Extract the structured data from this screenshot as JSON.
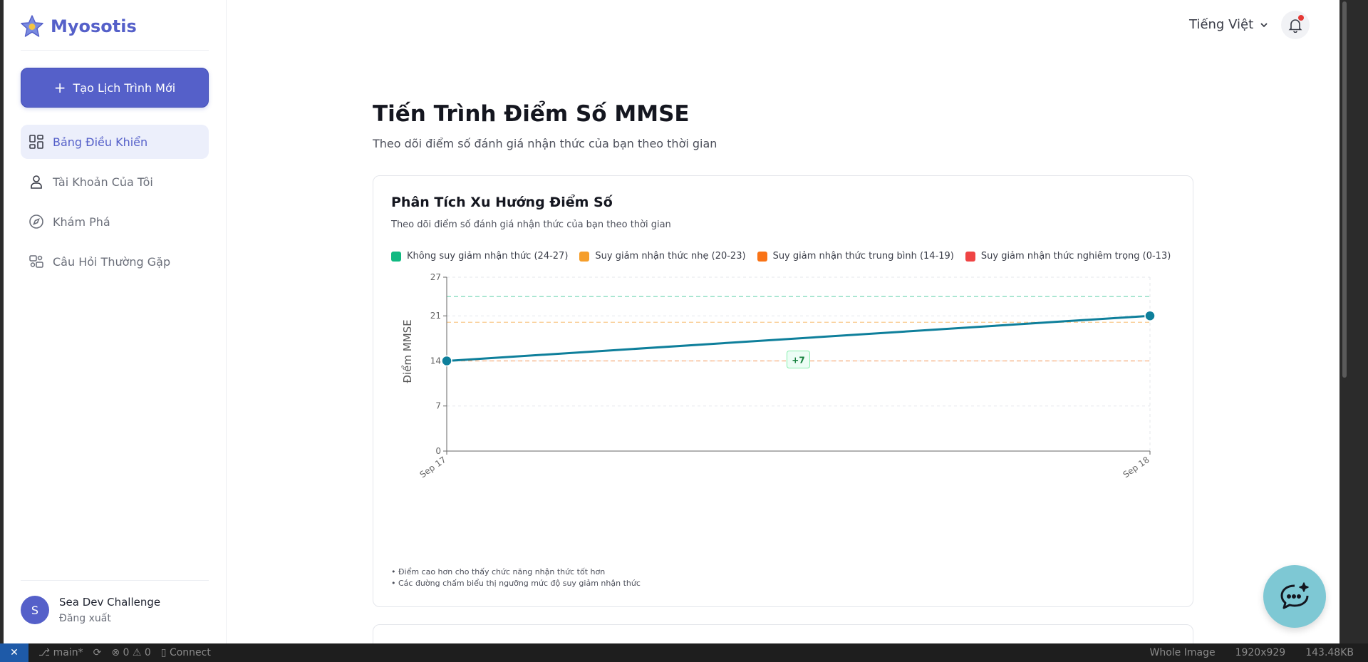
{
  "brand": {
    "name": "Myosotis"
  },
  "sidebar": {
    "new_button": "Tạo Lịch Trình Mới",
    "items": [
      {
        "label": "Bảng Điều Khiển",
        "icon": "dashboard-icon",
        "active": true
      },
      {
        "label": "Tài Khoản Của Tôi",
        "icon": "user-icon",
        "active": false
      },
      {
        "label": "Khám Phá",
        "icon": "compass-icon",
        "active": false
      },
      {
        "label": "Câu Hỏi Thường Gặp",
        "icon": "faq-icon",
        "active": false
      }
    ],
    "user": {
      "initial": "S",
      "name": "Sea Dev Challenge",
      "logout": "Đăng xuất"
    }
  },
  "header": {
    "language": "Tiếng Việt"
  },
  "main": {
    "title": "Tiến Trình Điểm Số MMSE",
    "subtitle": "Theo dõi điểm số đánh giá nhận thức của bạn theo thời gian",
    "card": {
      "title": "Phân Tích Xu Hướng Điểm Số",
      "subtitle": "Theo dõi điểm số đánh giá nhận thức của bạn theo thời gian",
      "legend": [
        {
          "label": "Không suy giảm nhận thức (24-27)",
          "color": "#10b981"
        },
        {
          "label": "Suy giảm nhận thức nhẹ (20-23)",
          "color": "#f59e2b"
        },
        {
          "label": "Suy giảm nhận thức trung bình (14-19)",
          "color": "#f97316"
        },
        {
          "label": "Suy giảm nhận thức nghiêm trọng (0-13)",
          "color": "#ef4444"
        }
      ],
      "notes": [
        "• Điểm cao hơn cho thấy chức năng nhận thức tốt hơn",
        "• Các đường chấm biểu thị ngưỡng mức độ suy giảm nhận thức"
      ]
    }
  },
  "chart_data": {
    "type": "line",
    "x": [
      "Sep 17",
      "Sep 18"
    ],
    "series": [
      {
        "values": [
          14,
          21
        ],
        "color": "#0e7f9b"
      }
    ],
    "ylabel": "Điểm MMSE",
    "xlabel": "",
    "ylim": [
      0,
      27
    ],
    "yticks": [
      0,
      7,
      14,
      21,
      27
    ],
    "thresholds": [
      {
        "value": 24,
        "color": "#10b981"
      },
      {
        "value": 20,
        "color": "#f59e2b"
      },
      {
        "value": 14,
        "color": "#f97316"
      }
    ],
    "annotation": "+7",
    "grid": true
  },
  "statusbar": {
    "branch": "main*",
    "problems": "0",
    "warnings": "0",
    "connect": "Connect",
    "mode": "Whole Image",
    "dimensions": "1920x929",
    "size": "143.48KB"
  }
}
